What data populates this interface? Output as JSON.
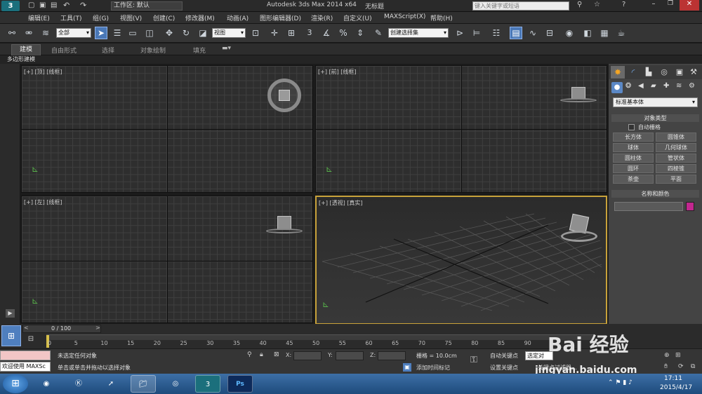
{
  "title": {
    "workspace_label": "工作区: 默认",
    "app_name": "Autodesk 3ds Max  2014 x64",
    "doc_name": "无标题",
    "search_placeholder": "键入关键字或短语"
  },
  "menu": [
    "编辑(E)",
    "工具(T)",
    "组(G)",
    "视图(V)",
    "创建(C)",
    "修改器(M)",
    "动画(A)",
    "图形编辑器(D)",
    "渲染(R)",
    "自定义(U)",
    "MAXScript(X)",
    "帮助(H)"
  ],
  "toolbar": {
    "selection_filter": "全部",
    "reference_coord": "视图",
    "named_selection": "创建选择集",
    "snap_label": "3"
  },
  "ribbon": {
    "tabs": [
      "建模",
      "自由形式",
      "选择",
      "对象绘制",
      "填充"
    ],
    "subtab": "多边形建模"
  },
  "viewports": [
    {
      "label": "[+] [顶] [线框]"
    },
    {
      "label": "[+] [前] [线框]"
    },
    {
      "label": "[+] [左] [线框]"
    },
    {
      "label": "[+] [透视] [真实]"
    }
  ],
  "command_panel": {
    "dropdown": "标准基本体",
    "object_type_title": "对象类型",
    "autogrid_label": "自动栅格",
    "buttons": [
      "长方体",
      "圆锥体",
      "球体",
      "几何球体",
      "圆柱体",
      "管状体",
      "圆环",
      "四棱锥",
      "茶壶",
      "平面"
    ],
    "name_color_title": "名称和颜色",
    "swatch_color": "#c2278f"
  },
  "timeline": {
    "counter": "0 / 100",
    "ticks": [
      "0",
      "5",
      "10",
      "15",
      "20",
      "25",
      "30",
      "35",
      "40",
      "45",
      "50",
      "55",
      "60",
      "65",
      "70",
      "75",
      "80",
      "85",
      "90"
    ]
  },
  "status": {
    "maxscript_text": "欢迎使用 MAXSc",
    "line1": "未选定任何对象",
    "line2": "单击或单击并拖动以选择对象",
    "x_label": "X:",
    "y_label": "Y:",
    "z_label": "Z:",
    "grid_text": "栅格 = 10.0cm",
    "add_time_tag": "添加时间标记",
    "auto_key": "自动关键点",
    "set_key": "设置关键点",
    "selected_label": "选定对",
    "key_filter": "关键点过滤器..."
  },
  "taskbar": {
    "time": "17:11",
    "date": "2015/4/17",
    "watermark_top": "Bai 经验",
    "watermark_url": "jingyan.baidu.com"
  }
}
